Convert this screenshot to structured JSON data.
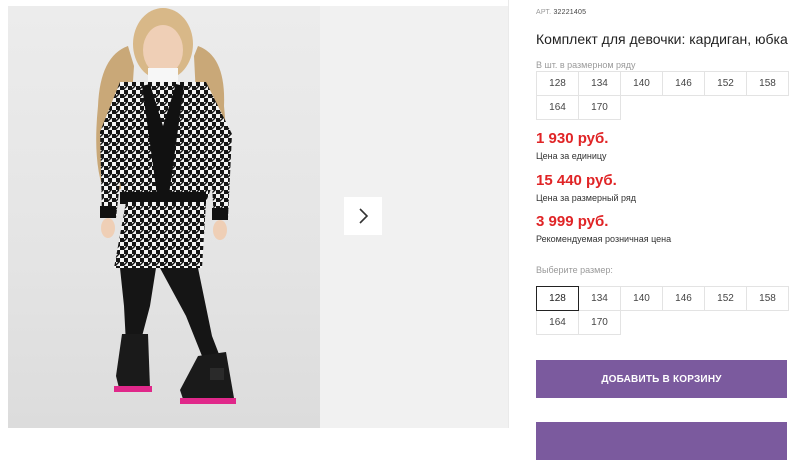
{
  "product": {
    "sku_prefix": "АРТ.",
    "sku": "32221405",
    "title": "Комплект для девочки: кардиган, юбка"
  },
  "pack_sizes": {
    "label": "В шт. в размерном ряду",
    "sizes": [
      "128",
      "134",
      "140",
      "146",
      "152",
      "158",
      "164",
      "170"
    ]
  },
  "prices": [
    {
      "value": "1 930 руб.",
      "caption": "Цена за единицу"
    },
    {
      "value": "15 440 руб.",
      "caption": "Цена за размерный ряд"
    },
    {
      "value": "3 999 руб.",
      "caption": "Рекомендуемая розничная цена"
    }
  ],
  "size_select": {
    "label": "Выберите размер:",
    "selected": "128",
    "sizes": [
      "128",
      "134",
      "140",
      "146",
      "152",
      "158",
      "164",
      "170"
    ]
  },
  "actions": {
    "add_to_cart": "ДОБАВИТЬ В КОРЗИНУ"
  },
  "colors": {
    "accent": "#7b5a9e",
    "price": "#e02426"
  },
  "icons": {
    "next": "chevron-right-icon"
  }
}
